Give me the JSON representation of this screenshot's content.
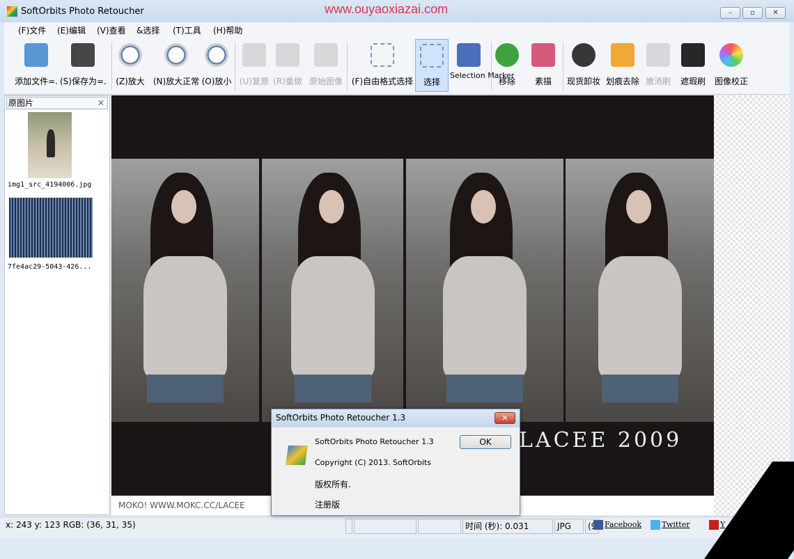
{
  "window": {
    "title": "SoftOrbits Photo Retoucher",
    "watermark": "www.ouyaoxiazai.com",
    "controls": [
      "–",
      "▫",
      "✕"
    ]
  },
  "menu": [
    "(F)文件",
    "(E)编辑",
    "(V)查看",
    "&选择",
    "(T)工具",
    "(H)帮助"
  ],
  "toolbar": [
    {
      "label": "添加文件=.",
      "icon": "add-file-icon",
      "color": "#4a8cd0",
      "disabled": false
    },
    {
      "label": "(S)保存为=.",
      "icon": "save-icon",
      "color": "#333",
      "disabled": false
    },
    {
      "label": "(Z)放大",
      "icon": "zoom-in-icon",
      "color": "#1a4fa0",
      "disabled": false
    },
    {
      "label": "(N)放大正常",
      "icon": "zoom-normal-icon",
      "color": "#1a4fa0",
      "disabled": false
    },
    {
      "label": "(O)放小",
      "icon": "zoom-out-icon",
      "color": "#1a4fa0",
      "disabled": false
    },
    {
      "label": "(U)复原",
      "icon": "undo-icon",
      "color": "#c4c4c4",
      "disabled": true
    },
    {
      "label": "(R)重做",
      "icon": "redo-icon",
      "color": "#c4c4c4",
      "disabled": true
    },
    {
      "label": "原始图像",
      "icon": "original-image-icon",
      "color": "#c4c4c4",
      "disabled": true
    },
    {
      "label": "(F)自由格式选择",
      "icon": "freeform-select-icon",
      "color": "#6a8fc8",
      "disabled": false
    },
    {
      "label": "选择",
      "icon": "rect-select-icon",
      "color": "#6a8fc8",
      "disabled": false,
      "selected": true
    },
    {
      "label": "Selection Marker",
      "icon": "marker-icon",
      "color": "#3a5fb0",
      "disabled": false
    },
    {
      "label": "移除",
      "icon": "remove-icon",
      "color": "#2a9a2a",
      "disabled": false
    },
    {
      "label": "素描",
      "icon": "sketch-icon",
      "color": "#d04a70",
      "disabled": false
    },
    {
      "label": "现货卸妆",
      "icon": "dropper-icon",
      "color": "#222",
      "disabled": false
    },
    {
      "label": "划痕去除",
      "icon": "roller-icon",
      "color": "#f0a020",
      "disabled": false
    },
    {
      "label": "撤消刷",
      "icon": "undo-brush-icon",
      "color": "#c4c4c4",
      "disabled": true
    },
    {
      "label": "遮瑕刷",
      "icon": "brush-icon",
      "color": "#111",
      "disabled": false
    },
    {
      "label": "图像校正",
      "icon": "color-wheel-icon",
      "color": "#e04080",
      "disabled": false
    }
  ],
  "left_panel": {
    "title": "原图片",
    "thumbnails": [
      "img1_src_4194006.jpg",
      "7fe4ac29-5043-426..."
    ]
  },
  "image": {
    "overlay_text": "LACEE 2009",
    "caption": "MOKO! WWW.MOKC.CC/LACEE"
  },
  "status": {
    "coords": "x: 243 y: 123  RGB: (36, 31, 35)",
    "time": "时间 (秒): 0.031",
    "format": "JPG",
    "extra": "(9",
    "social": [
      "Facebook",
      "Twitter",
      "Y"
    ]
  },
  "dialog": {
    "title": "SoftOrbits Photo Retoucher 1.3",
    "lines": [
      "SoftOrbits Photo Retoucher 1.3",
      "Copyright (C) 2013. SoftOrbits",
      "版权所有.",
      "注册版"
    ],
    "ok": "OK"
  }
}
